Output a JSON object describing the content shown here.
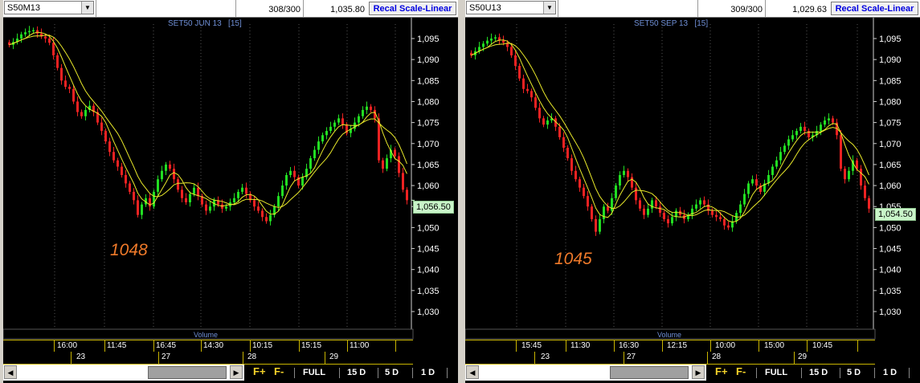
{
  "colors": {
    "up": "#22dd22",
    "down": "#ee2222",
    "ma": "#e8e82a",
    "axis": "#cfcfcf",
    "accent": "#6f8fd6",
    "dip": "#f07a2a"
  },
  "panels": [
    {
      "symbol": "S50M13",
      "counter": "308/300",
      "last_price": "1,035.80",
      "recal_label": "Recal Scale-Linear",
      "title": "SET50 JUN 13",
      "interval": "[15]",
      "yticks": [
        "1,095",
        "1,090",
        "1,085",
        "1,080",
        "1,075",
        "1,070",
        "1,065",
        "1,060",
        "1,055",
        "1,050",
        "1,045",
        "1,040",
        "1,035",
        "1,030"
      ],
      "current_price_label": "1,056.50",
      "current_price": 1056.5,
      "dip_annotation": "1048",
      "volume_label": "Volume",
      "time_labels": [
        "16:00",
        "11:45",
        "16:45",
        "14:30",
        "10:15",
        "15:15",
        "11:00"
      ],
      "date_labels": [
        "23",
        "27",
        "28",
        "29"
      ],
      "closes": [
        1093.5,
        1094.2,
        1095.0,
        1096.0,
        1096.5,
        1096.8,
        1097.0,
        1096.2,
        1095.5,
        1095.0,
        1094.0,
        1091.0,
        1088.0,
        1085.0,
        1083.5,
        1083.0,
        1080.0,
        1077.5,
        1076.5,
        1078.0,
        1079.0,
        1077.5,
        1075.0,
        1073.0,
        1070.5,
        1068.0,
        1066.0,
        1064.5,
        1062.5,
        1060.5,
        1058.5,
        1056.5,
        1053.0,
        1055.5,
        1057.0,
        1055.0,
        1058.5,
        1061.5,
        1063.5,
        1065.0,
        1064.0,
        1061.5,
        1059.0,
        1057.0,
        1056.0,
        1058.0,
        1059.5,
        1057.5,
        1055.5,
        1054.0,
        1055.0,
        1056.5,
        1055.5,
        1054.5,
        1055.0,
        1056.0,
        1057.0,
        1058.5,
        1059.5,
        1058.0,
        1056.5,
        1055.0,
        1054.0,
        1052.5,
        1051.5,
        1053.0,
        1055.0,
        1057.5,
        1060.0,
        1062.5,
        1063.5,
        1062.0,
        1060.0,
        1062.0,
        1064.0,
        1066.5,
        1068.5,
        1070.5,
        1072.0,
        1073.0,
        1074.0,
        1075.0,
        1076.0,
        1074.5,
        1072.5,
        1073.5,
        1075.0,
        1076.5,
        1078.0,
        1078.8,
        1078.0,
        1076.0,
        1066.0,
        1064.0,
        1066.5,
        1068.5,
        1067.0,
        1063.0,
        1059.0,
        1056.5
      ]
    },
    {
      "symbol": "S50U13",
      "counter": "309/300",
      "last_price": "1,029.63",
      "recal_label": "Recal Scale-Linear",
      "title": "SET50 SEP 13",
      "interval": "[15]",
      "yticks": [
        "1,095",
        "1,090",
        "1,085",
        "1,080",
        "1,075",
        "1,070",
        "1,065",
        "1,060",
        "1,055",
        "1,050",
        "1,045",
        "1,040",
        "1,035",
        "1,030"
      ],
      "current_price_label": "1,054.50",
      "current_price": 1054.5,
      "dip_annotation": "1045",
      "volume_label": "Volume",
      "time_labels": [
        "15:45",
        "11:30",
        "16:30",
        "12:15",
        "10:00",
        "15:00",
        "10:45"
      ],
      "date_labels": [
        "23",
        "27",
        "28",
        "29"
      ],
      "closes": [
        1091.0,
        1092.0,
        1093.0,
        1093.8,
        1094.5,
        1095.0,
        1095.3,
        1094.5,
        1094.0,
        1093.0,
        1091.0,
        1088.5,
        1085.5,
        1083.0,
        1082.5,
        1081.0,
        1078.5,
        1076.0,
        1074.5,
        1075.5,
        1076.0,
        1074.0,
        1071.5,
        1069.0,
        1066.5,
        1063.5,
        1061.5,
        1059.5,
        1057.5,
        1055.0,
        1052.0,
        1049.0,
        1052.0,
        1055.0,
        1054.0,
        1057.0,
        1060.0,
        1062.5,
        1063.5,
        1062.0,
        1059.5,
        1056.5,
        1054.5,
        1053.0,
        1054.5,
        1056.5,
        1055.0,
        1053.5,
        1052.0,
        1051.0,
        1052.5,
        1054.0,
        1053.0,
        1052.0,
        1053.0,
        1054.5,
        1055.5,
        1056.5,
        1055.5,
        1054.0,
        1053.0,
        1052.5,
        1052.0,
        1050.5,
        1050.0,
        1051.5,
        1053.5,
        1055.5,
        1058.0,
        1060.5,
        1061.5,
        1060.0,
        1058.5,
        1060.5,
        1062.5,
        1064.5,
        1066.0,
        1068.0,
        1069.5,
        1071.0,
        1072.0,
        1073.0,
        1074.0,
        1073.0,
        1071.5,
        1072.0,
        1073.0,
        1074.5,
        1075.5,
        1076.0,
        1075.0,
        1072.0,
        1064.0,
        1061.5,
        1063.5,
        1066.0,
        1064.0,
        1060.0,
        1057.0,
        1054.5
      ]
    }
  ],
  "bottom": {
    "f_plus": "F+",
    "f_minus": "F-",
    "periods": [
      "FULL",
      "15 D",
      "5 D",
      "1 D"
    ]
  },
  "icons": [
    "dropdown-arrow-icon",
    "scroll-left-icon",
    "scroll-right-icon"
  ]
}
